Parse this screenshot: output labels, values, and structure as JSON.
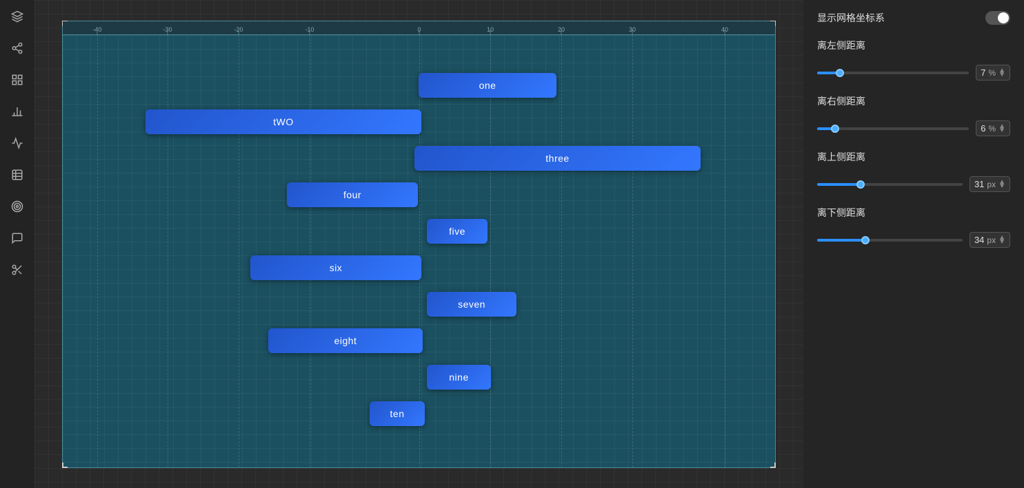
{
  "toolbar": {
    "icons": [
      "layers",
      "share",
      "grid",
      "chart-bar",
      "chart-line",
      "table",
      "target",
      "message",
      "scissors"
    ]
  },
  "canvas": {
    "ruler_marks": [
      "-40",
      "-30",
      "-20",
      "-10",
      "0",
      "10",
      "20",
      "30",
      "40"
    ],
    "bars": [
      {
        "id": "one",
        "label": "one"
      },
      {
        "id": "two",
        "label": "tWO"
      },
      {
        "id": "three",
        "label": "three"
      },
      {
        "id": "four",
        "label": "four"
      },
      {
        "id": "five",
        "label": "five"
      },
      {
        "id": "six",
        "label": "six"
      },
      {
        "id": "seven",
        "label": "seven"
      },
      {
        "id": "eight",
        "label": "eight"
      },
      {
        "id": "nine",
        "label": "nine"
      },
      {
        "id": "ten",
        "label": "ten"
      }
    ]
  },
  "panel": {
    "grid_label": "显示网格坐标系",
    "left_label": "离左侧距离",
    "left_value": "7",
    "left_unit": "%",
    "left_fill_pct": 15,
    "left_thumb_pct": 15,
    "right_label": "离右侧距离",
    "right_value": "6",
    "right_unit": "%",
    "right_fill_pct": 12,
    "right_thumb_pct": 12,
    "top_label": "离上侧距离",
    "top_value": "31",
    "top_unit": "px",
    "top_fill_pct": 30,
    "top_thumb_pct": 30,
    "bottom_label": "离下侧距离",
    "bottom_value": "34",
    "bottom_unit": "px",
    "bottom_fill_pct": 33,
    "bottom_thumb_pct": 33
  }
}
